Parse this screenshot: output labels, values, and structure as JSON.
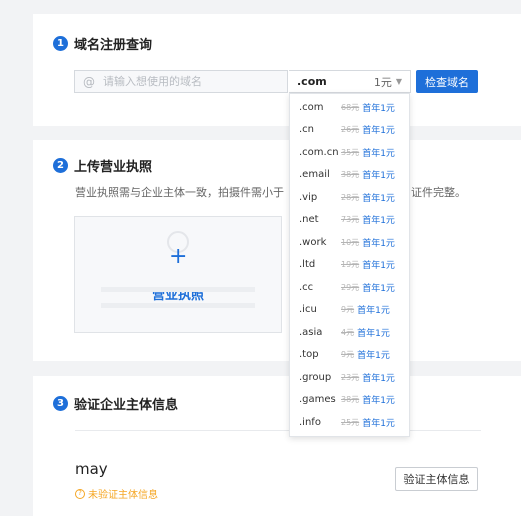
{
  "section1": {
    "number": "1",
    "title": "域名注册查询",
    "search_icon_text": "@",
    "search_placeholder": "请输入想使用的域名",
    "selected_suffix": ".com",
    "selected_price": "1元",
    "check_button": "检查域名"
  },
  "section2": {
    "number": "2",
    "title": "上传营业执照",
    "desc_left": "营业执照需与企业主体一致，拍摄件需小于",
    "desc_right": "证件完整。",
    "upload_plus": "+",
    "upload_label": "营业执照"
  },
  "section3": {
    "number": "3",
    "title": "验证企业主体信息",
    "user_name": "may",
    "status_icon": "?",
    "status_text": "未验证主体信息",
    "verify_button": "验证主体信息"
  },
  "dropdown": {
    "items": [
      {
        "suffix": ".com",
        "old_price": "68元",
        "new_price": "首年1元"
      },
      {
        "suffix": ".cn",
        "old_price": "26元",
        "new_price": "首年1元"
      },
      {
        "suffix": ".com.cn",
        "old_price": "35元",
        "new_price": "首年1元"
      },
      {
        "suffix": ".email",
        "old_price": "38元",
        "new_price": "首年1元"
      },
      {
        "suffix": ".vip",
        "old_price": "28元",
        "new_price": "首年1元"
      },
      {
        "suffix": ".net",
        "old_price": "73元",
        "new_price": "首年1元"
      },
      {
        "suffix": ".work",
        "old_price": "10元",
        "new_price": "首年1元"
      },
      {
        "suffix": ".ltd",
        "old_price": "19元",
        "new_price": "首年1元"
      },
      {
        "suffix": ".cc",
        "old_price": "29元",
        "new_price": "首年1元"
      },
      {
        "suffix": ".icu",
        "old_price": "9元",
        "new_price": "首年1元"
      },
      {
        "suffix": ".asia",
        "old_price": "4元",
        "new_price": "首年1元"
      },
      {
        "suffix": ".top",
        "old_price": "9元",
        "new_price": "首年1元"
      },
      {
        "suffix": ".group",
        "old_price": "23元",
        "new_price": "首年1元"
      },
      {
        "suffix": ".games",
        "old_price": "38元",
        "new_price": "首年1元"
      },
      {
        "suffix": ".info",
        "old_price": "25元",
        "new_price": "首年1元"
      }
    ]
  },
  "colors": {
    "accent": "#1e6fd9",
    "warning": "#f5a623",
    "background": "#f2f3f5"
  }
}
